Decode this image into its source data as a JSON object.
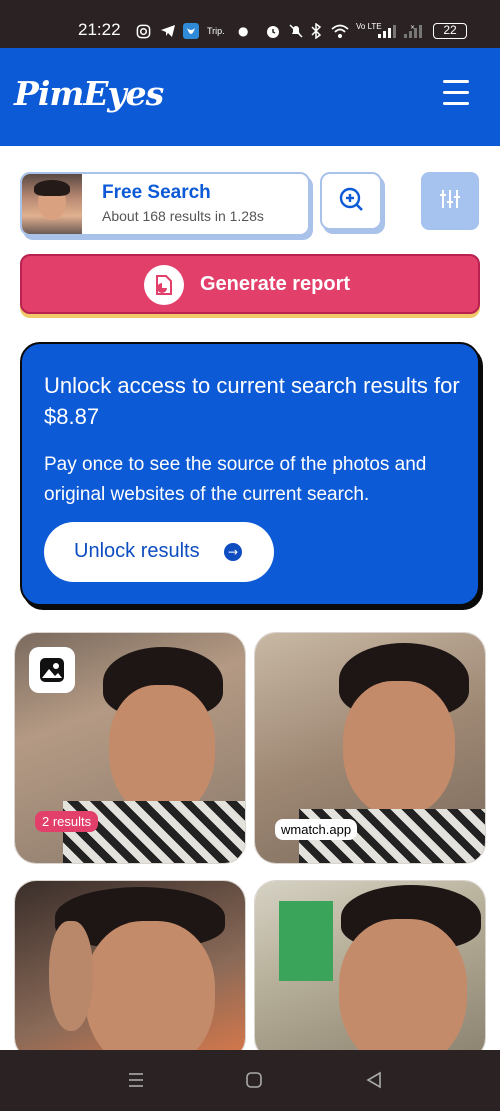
{
  "status_bar": {
    "time": "21:22",
    "trip_label": "Trip.",
    "network_label": "Vo LTE",
    "battery": "22",
    "icons": [
      "instagram-icon",
      "telegram-icon",
      "bluesky-icon",
      "alarm-icon",
      "mute-icon",
      "bluetooth-icon",
      "wifi-icon",
      "signal-icon"
    ]
  },
  "header": {
    "logo": "PimEyes",
    "menu_icon": "hamburger-icon"
  },
  "search": {
    "title": "Free Search",
    "subtitle": "About 168 results in 1.28s",
    "zoom_icon": "zoom-in-icon",
    "filter_icon": "sliders-icon"
  },
  "report": {
    "label": "Generate report",
    "icon": "report-icon"
  },
  "unlock": {
    "title": "Unlock access to current search results for $8.87",
    "description": "Pay once to see the source of the photos and original websites of the current search.",
    "button_label": "Unlock results",
    "arrow": "→"
  },
  "results": [
    {
      "badge": "2 results",
      "icon": "image-icon"
    },
    {
      "domain": "wmatch.app"
    },
    {},
    {}
  ],
  "colors": {
    "brand_blue": "#0d5ad6",
    "report_pink": "#e23f6b",
    "accent_light_blue": "#a6c3f0"
  },
  "nav": [
    "recents-icon",
    "home-icon",
    "back-icon"
  ]
}
